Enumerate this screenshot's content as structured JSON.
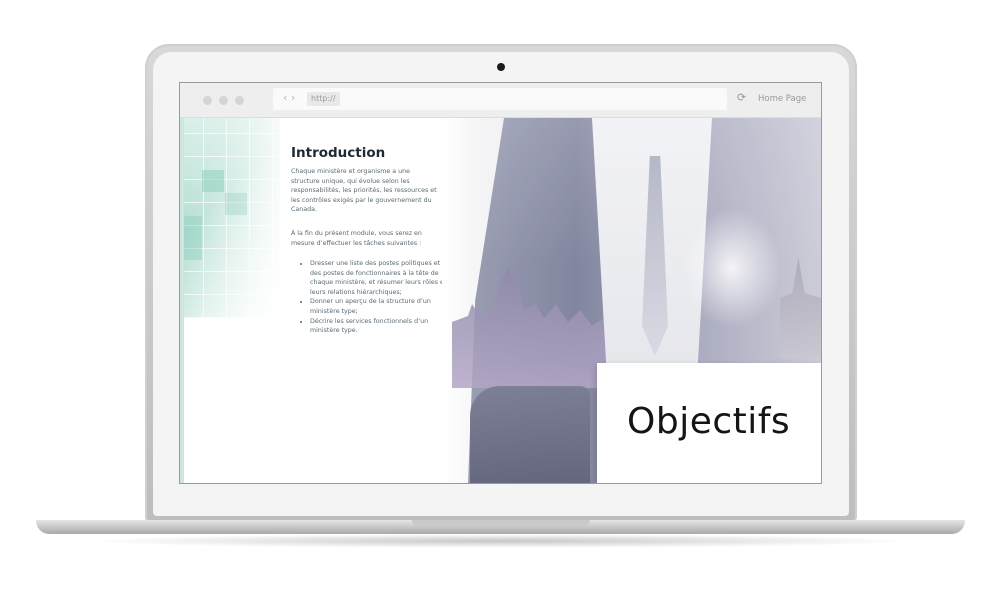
{
  "browser": {
    "url": "http://",
    "home_label": "Home Page"
  },
  "page": {
    "title": "Introduction",
    "paragraph1": "Chaque ministère et organisme a une structure unique, qui évolue selon les responsabilités, les priorités, les ressources et les contrôles exigés par le gouvernement du Canada.",
    "paragraph2": "À la fin du présent module, vous serez en mesure d’effectuer les tâches suivantes :",
    "bullets": [
      "Dresser une liste des postes politiques et des postes de fonctionnaires à la tête de chaque ministère, et résumer leurs rôles et leurs relations hiérarchiques;",
      "Donner un aperçu de la structure d’un ministère type;",
      "Décrire les services fonctionnels d’un ministère type."
    ]
  },
  "hero": {
    "sign_text": "Objectifs"
  },
  "colors": {
    "laptop": "#c8c8c8",
    "title": "#1f2a33",
    "body_text": "#5a6a73",
    "accent_teal": "#8fcfbf"
  },
  "icons": {
    "back": "chevron-left-icon",
    "forward": "chevron-right-icon",
    "reload": "reload-icon"
  }
}
